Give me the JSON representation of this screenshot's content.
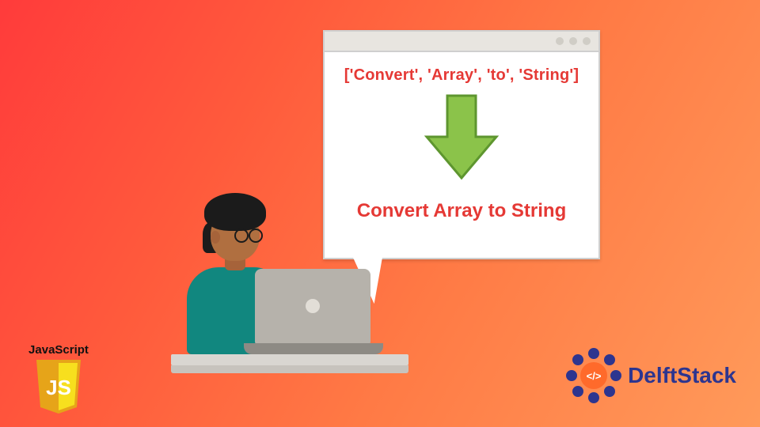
{
  "card": {
    "code_line": "['Convert', 'Array', 'to', 'String']",
    "result_line": "Convert Array to String"
  },
  "js_logo": {
    "label": "JavaScript",
    "badge_text": "JS"
  },
  "delft": {
    "brand": "DelftStack",
    "badge_glyph": "</>"
  },
  "window": {
    "dot_count": 3
  },
  "colors": {
    "accent_red": "#e53935",
    "arrow_green": "#8bc34a",
    "teal_shirt": "#11877f",
    "js_yellow": "#f7df1e",
    "delft_blue": "#2d358f"
  }
}
